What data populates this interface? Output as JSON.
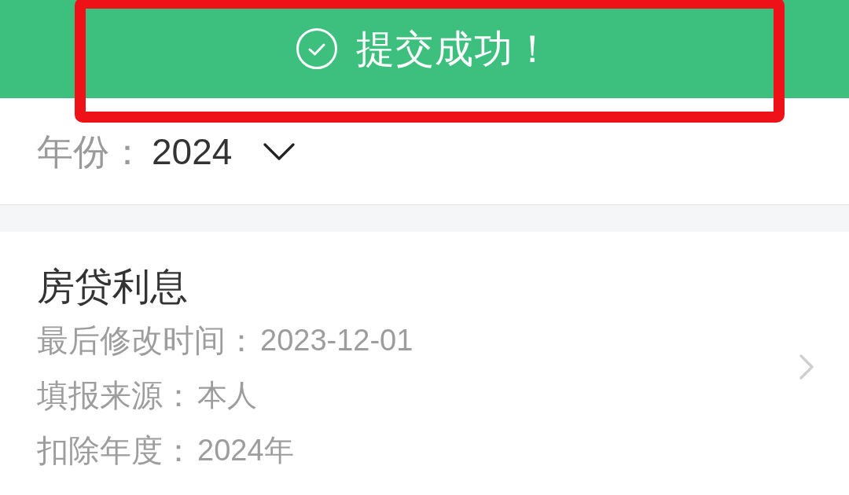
{
  "toast": {
    "message": "提交成功！"
  },
  "year_filter": {
    "label": "年份：",
    "value": "2024"
  },
  "records": [
    {
      "title": "房贷利息",
      "fields": [
        {
          "label": "最后修改时间：",
          "value": "2023-12-01"
        },
        {
          "label": "填报来源：",
          "value": "本人"
        },
        {
          "label": "扣除年度：",
          "value": "2024年"
        }
      ]
    }
  ]
}
